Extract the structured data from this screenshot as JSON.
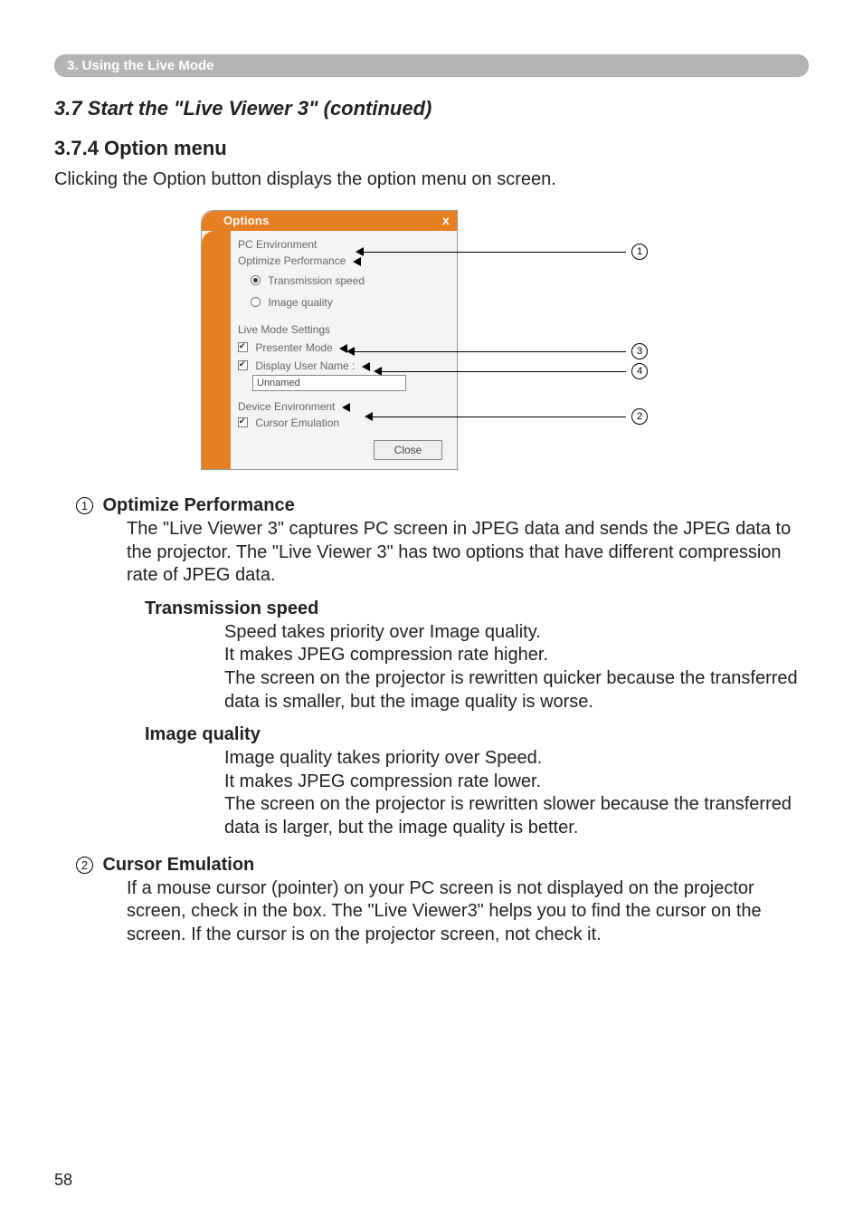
{
  "chapter_bar": "3. Using the Live Mode",
  "section_title": "3.7 Start the \"Live Viewer 3\" (continued)",
  "subsection_title": "3.7.4 Option menu",
  "intro_text": "Clicking the Option button displays the option menu on screen.",
  "dialog": {
    "title": "Options",
    "close_x": "x",
    "pc_env_label": "PC Environment",
    "optimize_label": "Optimize Performance",
    "radio_transmission": "Transmission speed",
    "radio_image_quality": "Image quality",
    "live_mode_label": "Live Mode Settings",
    "presenter_label": "Presenter Mode",
    "display_user_label": "Display User Name :",
    "username_value": "Unnamed",
    "device_env_label": "Device Environment",
    "cursor_em_label": "Cursor Emulation",
    "close_btn": "Close"
  },
  "callouts": {
    "c1": "1",
    "c2": "2",
    "c3": "3",
    "c4": "4"
  },
  "desc": {
    "n1": "1",
    "t1": "Optimize Performance",
    "b1": "The \"Live Viewer 3\" captures PC screen in JPEG data and sends the JPEG data to the projector. The \"Live Viewer 3\" has two options that have different compression rate of JPEG data.",
    "sub_ts_title": "Transmission speed",
    "sub_ts_body": "Speed takes priority over Image quality.\nIt makes JPEG compression rate higher.\nThe screen on the projector is rewritten quicker because the transferred data is smaller, but the image quality is worse.",
    "sub_iq_title": "Image quality",
    "sub_iq_body": "Image quality takes priority over Speed.\nIt makes JPEG compression rate lower.\nThe screen on the projector is rewritten slower because the transferred data is larger, but the image quality is better.",
    "n2": "2",
    "t2": "Cursor Emulation",
    "b2": "If a mouse cursor (pointer) on your PC screen is not displayed on the projector screen, check in the box. The \"Live Viewer3\" helps you to find the cursor on the screen.  If the cursor is on the projector screen, not check it."
  },
  "page_number": "58"
}
